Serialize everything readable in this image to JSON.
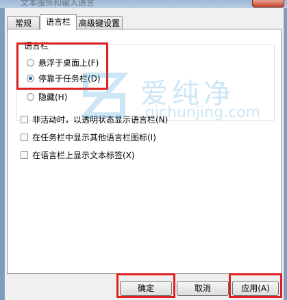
{
  "window": {
    "title": "文本服务和输入语言"
  },
  "tabs": [
    {
      "label": "常规"
    },
    {
      "label": "语言栏"
    },
    {
      "label": "高级键设置"
    }
  ],
  "language_bar": {
    "group_label": "语言栏",
    "options": [
      {
        "label": "悬浮于桌面上(F)",
        "selected": false
      },
      {
        "label": "停靠于任务栏(D)",
        "selected": true
      },
      {
        "label": "隐藏(H)",
        "selected": false
      }
    ]
  },
  "checkboxes": [
    {
      "label": "非活动时，以透明状态显示语言栏(N)",
      "checked": false
    },
    {
      "label": "在任务栏中显示其他语言栏图标(I)",
      "checked": false
    },
    {
      "label": "在语言栏上显示文本标签(X)",
      "checked": false
    }
  ],
  "buttons": {
    "ok": "确定",
    "cancel": "取消",
    "apply": "应用(A)"
  },
  "watermark": {
    "brand": "爱纯净",
    "url": "qichunjing.com"
  },
  "colors": {
    "highlight": "#e02020",
    "watermark": "#1a8fd6"
  }
}
